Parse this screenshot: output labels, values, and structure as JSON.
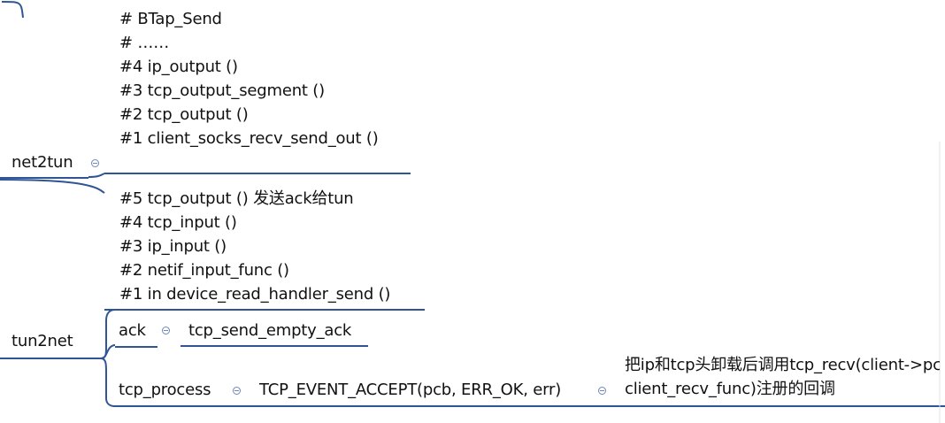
{
  "map": {
    "net2tun": {
      "label": "net2tun",
      "stack": [
        "# BTap_Send",
        "# ……",
        "#4   ip_output ()",
        "#3  tcp_output_segment ()",
        "#2  tcp_output ()",
        "#1   client_socks_recv_send_out ()"
      ]
    },
    "tun2net": {
      "label": "tun2net",
      "stack": [
        "#5   tcp_output () 发送ack给tun",
        "#4   tcp_input ()",
        "#3    ip_input ()",
        "#2  netif_input_func ()",
        "#1   in device_read_handler_send ()"
      ],
      "ack": {
        "label": "ack",
        "child": "tcp_send_empty_ack"
      },
      "tcp_process": {
        "label": "tcp_process",
        "child": "TCP_EVENT_ACCEPT(pcb, ERR_OK, err)",
        "note_lines": [
          "把ip和tcp头卸载后调用tcp_recv(client->pcb,",
          "client_recv_func)注册的回调"
        ]
      }
    }
  },
  "colors": {
    "line": "#2f5597",
    "toggle": "#6f88b8"
  }
}
